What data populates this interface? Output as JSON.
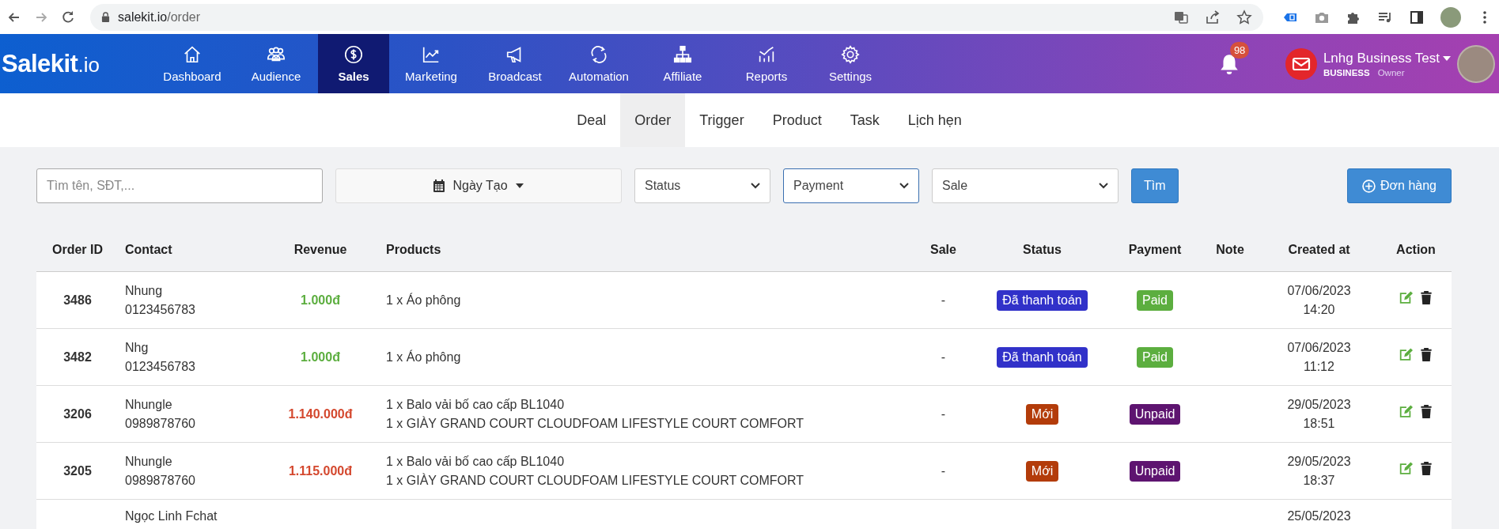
{
  "browser": {
    "url_host": "salekit.io",
    "url_path": "/order"
  },
  "nav": {
    "logo": "Salekit",
    "logo_suffix": ".io",
    "items": [
      {
        "label": "Dashboard",
        "kind": "house",
        "selected": false
      },
      {
        "label": "Audience",
        "kind": "people",
        "selected": false
      },
      {
        "label": "Sales",
        "kind": "dollar",
        "selected": true
      },
      {
        "label": "Marketing",
        "kind": "chart",
        "selected": false
      },
      {
        "label": "Broadcast",
        "kind": "megaphone",
        "selected": false
      },
      {
        "label": "Automation",
        "kind": "cycle",
        "selected": false
      },
      {
        "label": "Affiliate",
        "kind": "hierarchy",
        "selected": false
      },
      {
        "label": "Reports",
        "kind": "bars",
        "selected": false
      },
      {
        "label": "Settings",
        "kind": "gear",
        "selected": false
      }
    ],
    "notifications": "98",
    "user": {
      "name": "Lnhg Business Test",
      "plan": "BUSINESS",
      "role": "Owner"
    }
  },
  "subtabs": [
    {
      "label": "Deal",
      "selected": false
    },
    {
      "label": "Order",
      "selected": true
    },
    {
      "label": "Trigger",
      "selected": false
    },
    {
      "label": "Product",
      "selected": false
    },
    {
      "label": "Task",
      "selected": false
    },
    {
      "label": "Lịch hẹn",
      "selected": false
    }
  ],
  "filters": {
    "search_placeholder": "Tìm tên, SĐT,...",
    "date": "Ngày Tạo",
    "status": "Status",
    "payment": "Payment",
    "sale": "Sale",
    "search_button": "Tìm",
    "add_button": "Đơn hàng"
  },
  "table": {
    "columns": [
      "Order ID",
      "Contact",
      "Revenue",
      "Products",
      "Sale",
      "Status",
      "Payment",
      "Note",
      "Created at",
      "Action"
    ],
    "rows": [
      {
        "id": "3486",
        "name": "Nhung",
        "phone": "0123456783",
        "revenue": "1.000đ",
        "paid": true,
        "products": [
          "1 x Áo phông"
        ],
        "sale": "-",
        "status": {
          "label": "Đã thanh toán",
          "color": "#3131c9"
        },
        "payment": "Paid",
        "date": "07/06/2023",
        "time": "14:20"
      },
      {
        "id": "3482",
        "name": "Nhg",
        "phone": "0123456783",
        "revenue": "1.000đ",
        "paid": true,
        "products": [
          "1 x Áo phông"
        ],
        "sale": "-",
        "status": {
          "label": "Đã thanh toán",
          "color": "#3131c9"
        },
        "payment": "Paid",
        "date": "07/06/2023",
        "time": "11:12"
      },
      {
        "id": "3206",
        "name": "Nhungle",
        "phone": "0989878760",
        "revenue": "1.140.000đ",
        "paid": false,
        "products": [
          "1 x Balo vải bố cao cấp BL1040",
          "1 x GIÀY GRAND COURT CLOUDFOAM LIFESTYLE COURT COMFORT"
        ],
        "sale": "-",
        "status": {
          "label": "Mới",
          "color": "#b33c0a"
        },
        "payment": "Unpaid",
        "date": "29/05/2023",
        "time": "18:51"
      },
      {
        "id": "3205",
        "name": "Nhungle",
        "phone": "0989878760",
        "revenue": "1.115.000đ",
        "paid": false,
        "products": [
          "1 x Balo vải bố cao cấp BL1040",
          "1 x GIÀY GRAND COURT CLOUDFOAM LIFESTYLE COURT COMFORT"
        ],
        "sale": "-",
        "status": {
          "label": "Mới",
          "color": "#b33c0a"
        },
        "payment": "Unpaid",
        "date": "29/05/2023",
        "time": "18:37"
      },
      {
        "name": "Ngọc Linh Fchat",
        "date": "25/05/2023"
      }
    ]
  }
}
